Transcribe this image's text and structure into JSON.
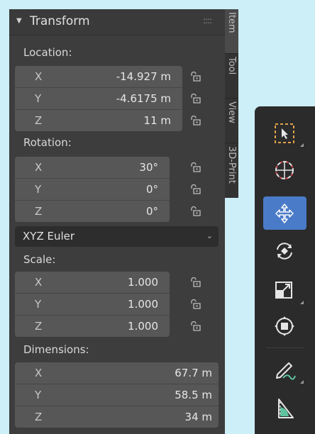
{
  "panel": {
    "title": "Transform",
    "location": {
      "label": "Location:",
      "rows": [
        {
          "axis": "X",
          "value": "-14.927 m"
        },
        {
          "axis": "Y",
          "value": "-4.6175 m"
        },
        {
          "axis": "Z",
          "value": "11 m"
        }
      ]
    },
    "rotation": {
      "label": "Rotation:",
      "rows": [
        {
          "axis": "X",
          "value": "30°"
        },
        {
          "axis": "Y",
          "value": "0°"
        },
        {
          "axis": "Z",
          "value": "0°"
        }
      ],
      "mode": "XYZ Euler"
    },
    "scale": {
      "label": "Scale:",
      "rows": [
        {
          "axis": "X",
          "value": "1.000"
        },
        {
          "axis": "Y",
          "value": "1.000"
        },
        {
          "axis": "Z",
          "value": "1.000"
        }
      ]
    },
    "dimensions": {
      "label": "Dimensions:",
      "rows": [
        {
          "axis": "X",
          "value": "67.7 m"
        },
        {
          "axis": "Y",
          "value": "58.5 m"
        },
        {
          "axis": "Z",
          "value": "34 m"
        }
      ]
    }
  },
  "side_tabs": [
    "Item",
    "Tool",
    "View",
    "3D-Print"
  ],
  "toolbar": {
    "tools": [
      "select-box",
      "cursor",
      "move",
      "rotate",
      "scale",
      "transform",
      "annotate",
      "measure"
    ],
    "active_tool": "move"
  },
  "colors": {
    "background": "#cdeff7",
    "panel": "#3d3d3d",
    "field": "#575757",
    "active_tool": "#4a7bc8"
  }
}
